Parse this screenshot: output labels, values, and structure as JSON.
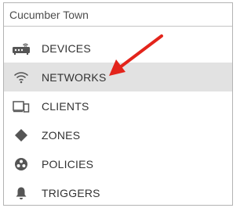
{
  "location_selector": {
    "value": "Cucumber Town"
  },
  "nav": {
    "items": [
      {
        "label": "DEVICES",
        "icon": "device-router-icon"
      },
      {
        "label": "NETWORKS",
        "icon": "wifi-icon",
        "active": true
      },
      {
        "label": "CLIENTS",
        "icon": "clients-icon"
      },
      {
        "label": "ZONES",
        "icon": "zones-diamond-icon"
      },
      {
        "label": "POLICIES",
        "icon": "policies-icon"
      },
      {
        "label": "TRIGGERS",
        "icon": "bell-icon"
      }
    ]
  },
  "colors": {
    "active_background": "#e2e2e2",
    "icon": "#555555",
    "annotation_arrow": "#e3241b"
  }
}
